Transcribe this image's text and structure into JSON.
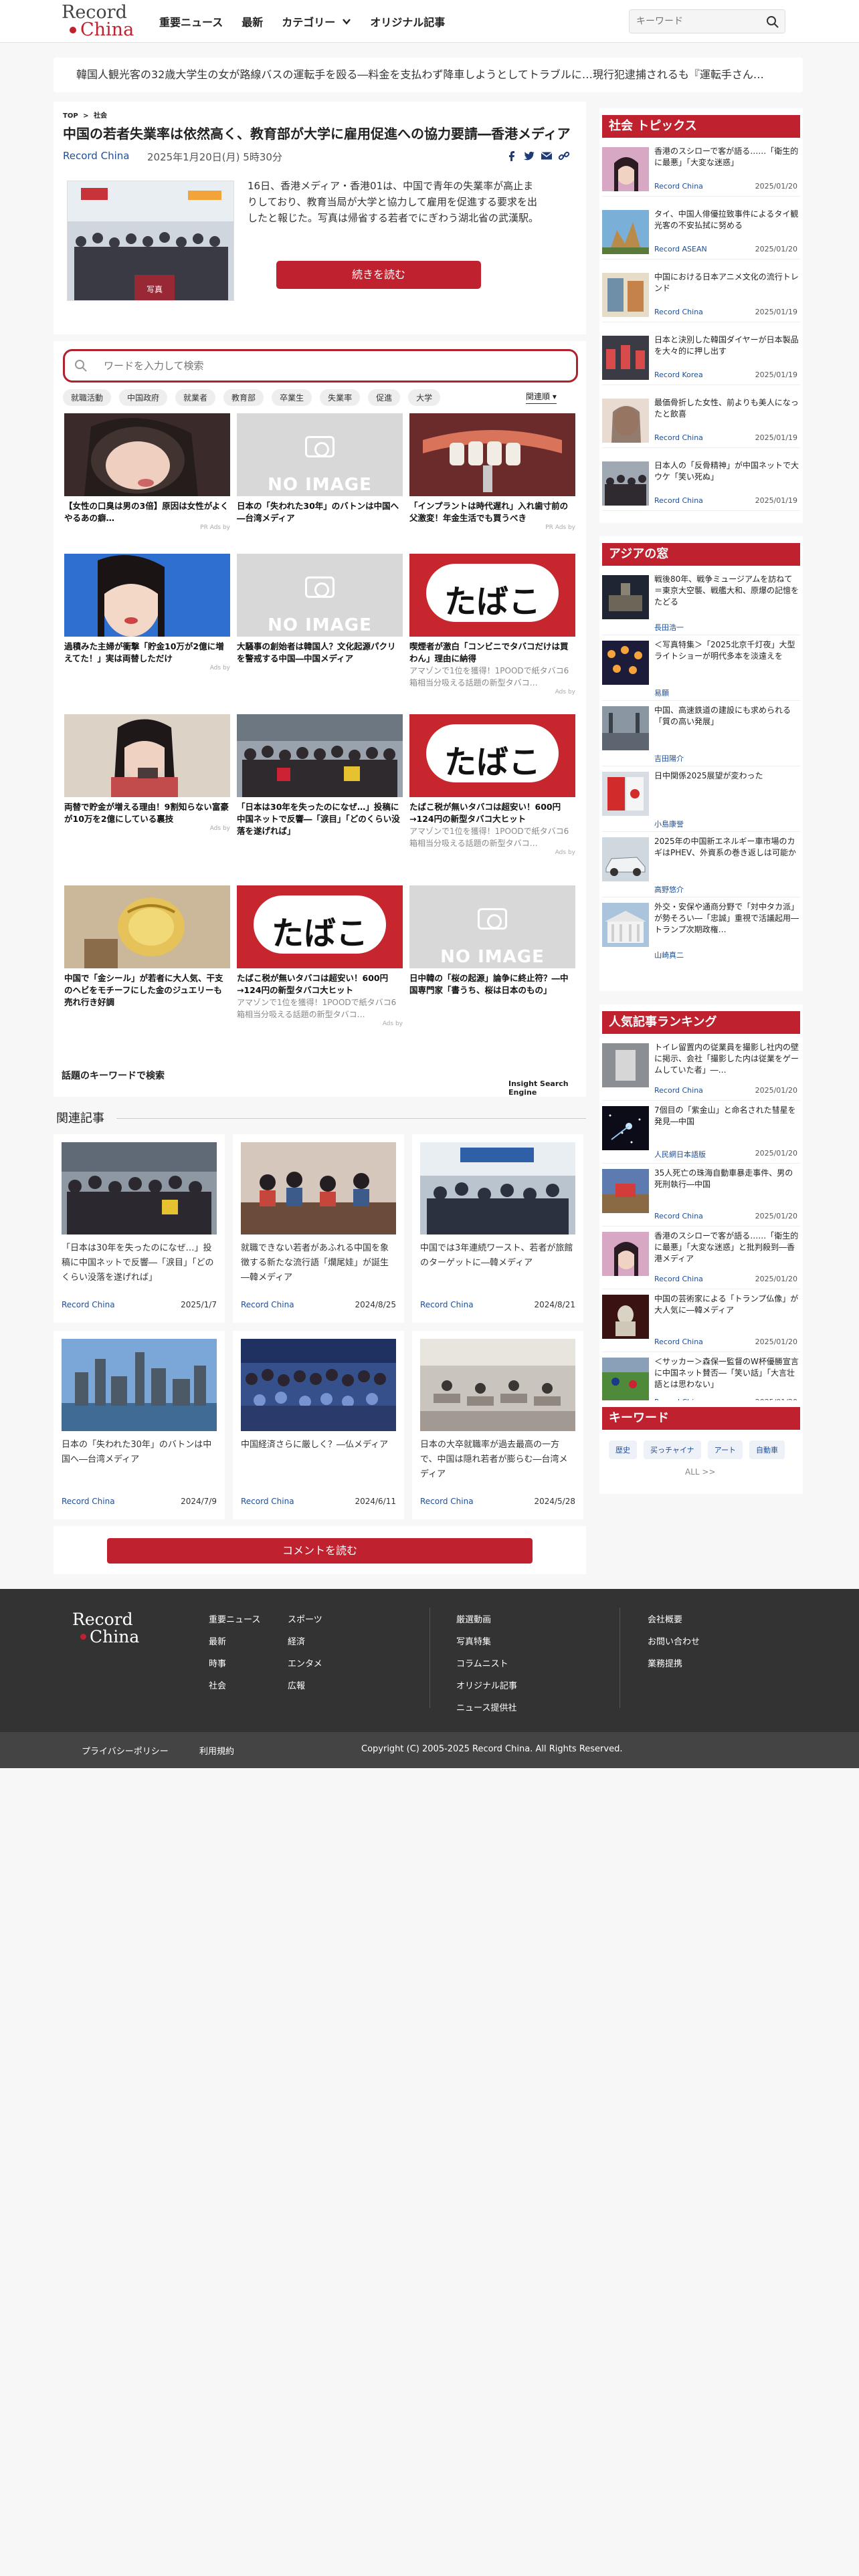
{
  "header": {
    "logo_top": "Record",
    "logo_bottom": "China",
    "nav": [
      "重要ニュース",
      "最新",
      "カテゴリー",
      "オリジナル記事"
    ],
    "search_placeholder": "キーワード"
  },
  "ticker": "韓国人観光客の32歳大学生の女が路線バスの運転手を殴る―料金を支払わず降車しようとしてトラブルに…現行犯逮捕されるも『運転手さん…",
  "article": {
    "breadcrumb_top": "TOP",
    "breadcrumb_sep": ">",
    "breadcrumb_cat": "社会",
    "title": "中国の若者失業率は依然高く、教育部が大学に雇用促進への協力要請―香港メディア",
    "source": "Record China",
    "date": "2025年1月20日(月) 5時30分",
    "image_label": "写真",
    "lead": "16日、香港メディア・香港01は、中国で青年の失業率が高止まりしており、教育当局が大学と協力して雇用を促進する要求を出したと報じた。写真は帰省する若者でにぎわう湖北省の武漢駅。",
    "read_more": "続きを読む"
  },
  "grid": {
    "search_placeholder": "ワードを入力して検索",
    "tags": [
      "就職活動",
      "中国政府",
      "就業者",
      "教育部",
      "卒業生",
      "失業率",
      "促進",
      "大学"
    ],
    "sort_label": "関連順",
    "cards": [
      {
        "caption": "【女性の口臭は男の3倍】原因は女性がよくやるあの癖…",
        "sub": "",
        "meta": "PR Ads by"
      },
      {
        "caption": "日本の「失われた30年」のバトンは中国へ―台湾メディア",
        "sub": "",
        "meta": ""
      },
      {
        "caption": "「インプラントは時代遅れ」入れ歯寸前の父激変！年金生活でも買うべき",
        "sub": "",
        "meta": "PR Ads by"
      },
      {
        "caption": "過積みた主婦が衝撃「貯金10万が2億に増えてた！」実は両替しただけ",
        "sub": "",
        "meta": "Ads by"
      },
      {
        "caption": "大騒事の創始者は韓国人？文化起源パクリを警戒する中国―中国メディア",
        "sub": "",
        "meta": ""
      },
      {
        "caption": "喫煙者が激白「コンビニでタバコだけは買わん」理由に納得",
        "sub": "アマゾンで1位を獲得！1POODで紙タバコ6箱相当分吸える話題の新型タバコ…",
        "meta": "Ads by"
      },
      {
        "caption": "両替で貯金が増える理由！9割知らない富豪が10万を2億にしている裏技",
        "sub": "",
        "meta": "Ads by"
      },
      {
        "caption": "「日本は30年を失ったのになぜ…」投稿に中国ネットで反響―「涙目」「どのくらい没落を遂げれば」",
        "sub": "",
        "meta": ""
      },
      {
        "caption": "たばこ税が無いタバコは超安い！600円→124円の新型タバコ大ヒット",
        "sub": "アマゾンで1位を獲得！1POODで紙タバコ6箱相当分吸える話題の新型タバコ…",
        "meta": "Ads by"
      },
      {
        "caption": "中国で「金シール」が若者に大人気、干支のヘビをモチーフにした金のジュエリーも売れ行き好調",
        "sub": "",
        "meta": ""
      },
      {
        "caption": "たばこ税が無いタバコは超安い！600円→124円の新型タバコ大ヒット",
        "sub": "アマゾンで1位を獲得！1POODで紙タバコ6箱相当分吸える話題の新型タバコ…",
        "meta": "Ads by"
      },
      {
        "caption": "日中韓の「桜の起源」論争に終止符？―中国専門家「書うち、桜は日本のもの」",
        "sub": "",
        "meta": ""
      }
    ],
    "no_image": "NO IMAGE",
    "tabako": "たばこ",
    "kw_line": "話題のキーワードで検索",
    "engine": "Insight Search Engine"
  },
  "related": {
    "heading": "関連記事",
    "items": [
      {
        "title": "「日本は30年を失ったのになぜ…」投稿に中国ネットで反響―「涙目」「どのくらい没落を遂げれば」",
        "source": "Record China",
        "date": "2025/1/7"
      },
      {
        "title": "就職できない若者があふれる中国を象徴する新たな流行語「爛尾娃」が誕生―韓メディア",
        "source": "Record China",
        "date": "2024/8/25"
      },
      {
        "title": "中国では3年連続ワースト、若者が旅館のターゲットに―韓メディア",
        "source": "Record China",
        "date": "2024/8/21"
      },
      {
        "title": "日本の「失われた30年」のバトンは中国へ―台湾メディア",
        "source": "Record China",
        "date": "2024/7/9"
      },
      {
        "title": "中国経済さらに厳しく？―仏メディア",
        "source": "Record China",
        "date": "2024/6/11"
      },
      {
        "title": "日本の大卒就職率が過去最高の一方で、中国は隠れ若者が膨らむ―台湾メディア",
        "source": "Record China",
        "date": "2024/5/28"
      }
    ],
    "comment_button": "コメントを読む"
  },
  "sidebar": {
    "topics": {
      "heading": "社会 トピックス",
      "items": [
        {
          "title": "香港のスシローで客が語る……「衛生的に最悪」「大変な迷惑」",
          "source": "Record China",
          "date": "2025/01/20"
        },
        {
          "title": "タイ、中国人俳優拉致事件によるタイ観光客の不安払拭に努める",
          "source": "Record ASEAN",
          "date": "2025/01/20"
        },
        {
          "title": "中国における日本アニメ文化の流行トレンド",
          "source": "Record China",
          "date": "2025/01/19"
        },
        {
          "title": "日本と決別した韓国ダイヤーが日本製品を大々的に押し出す",
          "source": "Record Korea",
          "date": "2025/01/19"
        },
        {
          "title": "最価骨折した女性、前よりも美人になったと飲喜",
          "source": "Record China",
          "date": "2025/01/19"
        },
        {
          "title": "日本人の「反骨精神」が中国ネットで大ウケ「笑い死ぬ」",
          "source": "Record China",
          "date": "2025/01/19"
        }
      ]
    },
    "asia": {
      "heading": "アジアの窓",
      "items": [
        {
          "title": "戦後80年、戦争ミュージアムを訪ねて＝東京大空襲、戦艦大和、原爆の記憶をたどる",
          "author": "長田浩一"
        },
        {
          "title": "＜写真特集＞「2025北京千灯夜」大型ライトショーが明代多本を淡遠えを",
          "author": "易願"
        },
        {
          "title": "中国、高速鉄道の建設にも求められる「質の高い発展」",
          "author": "吉田陽介"
        },
        {
          "title": "日中関係2025展望が変わった",
          "author": "小島康誉"
        },
        {
          "title": "2025年の中国新エネルギー車市場のカギはPHEV、外資系の巻き返しは可能か",
          "author": "高野悠介"
        },
        {
          "title": "外交・安保や通商分野で「対中タカ派」が勢そろい―「忠誠」重視で活議起用―トランプ次期政権…",
          "author": "山崎真二"
        }
      ]
    },
    "ranking": {
      "heading": "人気記事ランキング",
      "items": [
        {
          "title": "トイレ留置内の従業員を撮影し社内の壁に掲示、会社「撮影した内は従業をゲームしていた者」―…",
          "source": "Record China",
          "date": "2025/01/20"
        },
        {
          "title": "7個目の「紫金山」と命名された彗星を発見―中国",
          "source": "人民網日本語版",
          "date": "2025/01/20"
        },
        {
          "title": "35人死亡の珠海自動車暴走事件、男の死刑執行―中国",
          "source": "Record China",
          "date": "2025/01/20"
        },
        {
          "title": "香港のスシローで客が語る……「衛生的に最悪」「大変な迷惑」と批判殺到―香港メディア",
          "source": "Record China",
          "date": "2025/01/20"
        },
        {
          "title": "中国の芸術家による「トランプ仏像」が大人気に―韓メディア",
          "source": "Record China",
          "date": "2025/01/20"
        },
        {
          "title": "＜サッカー＞森保一監督のW杯優勝宣言に中国ネット賛否―「笑い話」「大言壮語とは思わない」",
          "source": "Record China",
          "date": "2025/01/20"
        }
      ]
    },
    "keywords": {
      "heading": "キーワード",
      "tags": [
        "歴史",
        "买っチャイナ",
        "アート",
        "自動車"
      ],
      "all_label": "ALL >>"
    }
  },
  "footer": {
    "logo_top": "Record",
    "logo_bottom": "China",
    "col1": [
      "重要ニュース",
      "最新",
      "時事",
      "社会"
    ],
    "col2": [
      "スポーツ",
      "経済",
      "エンタメ",
      "広報"
    ],
    "col3": [
      "厳選動画",
      "写真特集",
      "コラムニスト",
      "オリジナル記事",
      "ニュース提供社"
    ],
    "col4": [
      "会社概要",
      "お問い合わせ",
      "業務提携"
    ],
    "privacy": "プライバシーポリシー",
    "terms": "利用規約",
    "copyright": "Copyright (C) 2005-2025 Record China. All Rights Reserved."
  },
  "colors": {
    "brand_red": "#c0212e",
    "link_blue": "#1e4e96",
    "footer_bg": "#333333"
  }
}
